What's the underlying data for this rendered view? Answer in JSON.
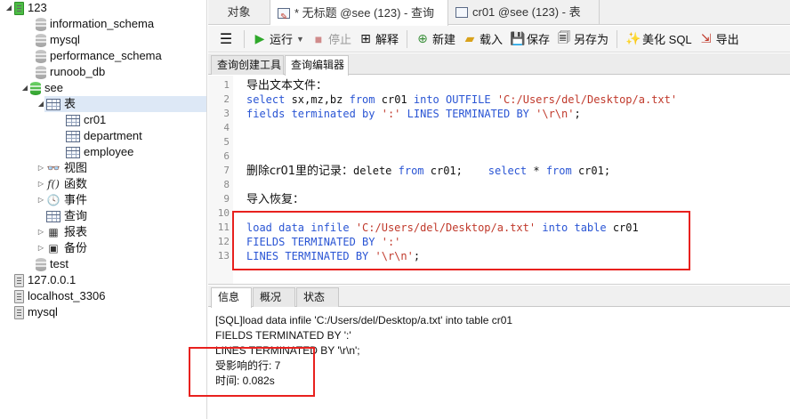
{
  "tree": {
    "conn_123": "123",
    "dbs_123": [
      "information_schema",
      "mysql",
      "performance_schema",
      "runoob_db"
    ],
    "see_db": "see",
    "tables_folder": "表",
    "tables": [
      "cr01",
      "department",
      "employee"
    ],
    "folders": [
      "视图",
      "函数",
      "事件",
      "查询",
      "报表",
      "备份"
    ],
    "test_db": "test",
    "other_connections": [
      "127.0.0.1",
      "localhost_3306",
      "mysql"
    ]
  },
  "top_tabs": [
    "对象",
    "* 无标题 @see (123) - 查询",
    "cr01 @see (123) - 表"
  ],
  "toolbar": {
    "menu_icon": "hamburger-icon",
    "run": "运行",
    "stop": "停止",
    "explain": "解释",
    "new": "新建",
    "load": "载入",
    "save": "保存",
    "save_as": "另存为",
    "beautify": "美化 SQL",
    "export": "导出"
  },
  "sub_tabs": [
    "查询创建工具",
    "查询编辑器"
  ],
  "editor": {
    "line_numbers": [
      "1",
      "2",
      "3",
      "4",
      "5",
      "6",
      "7",
      "8",
      "9",
      "10",
      "11",
      "12",
      "13"
    ],
    "line1": "导出文本文件：",
    "line2": {
      "kw_select": "select",
      "cols": " sx,mz,bz ",
      "kw_from": "from",
      "tbl": " cr01 ",
      "kw_into": "into",
      "sp": " ",
      "kw_outfile": "OUTFILE",
      "path": " 'C:/Users/del/Desktop/a.txt'"
    },
    "line3": {
      "kw1": "fields terminated by",
      "s1": " ':' ",
      "kw2": "LINES TERMINATED BY",
      "s2": " '\\r\\n'",
      "end": ";"
    },
    "line7": {
      "zh": "删除cr01里的记录：",
      "p1": "delete ",
      "kw_from1": "from",
      "p2": " cr01;    ",
      "kw_select": "select",
      "p3": " * ",
      "kw_from2": "from",
      "p4": " cr01;"
    },
    "line9": "导入恢复：",
    "line11": {
      "kw1": "load data infile",
      "path": " 'C:/Users/del/Desktop/a.txt' ",
      "kw2": "into table",
      "tbl": " cr01"
    },
    "line12": {
      "kw": "FIELDS TERMINATED BY",
      "s": " ':'"
    },
    "line13": {
      "kw": "LINES TERMINATED BY",
      "s": " '\\r\\n'",
      "end": ";"
    }
  },
  "result_tabs": [
    "信息",
    "概况",
    "状态"
  ],
  "result": {
    "lines": [
      "[SQL]load data infile 'C:/Users/del/Desktop/a.txt' into table cr01",
      "FIELDS TERMINATED BY ':'",
      "LINES TERMINATED BY '\\r\\n';",
      "受影响的行: 7",
      "时间: 0.082s"
    ]
  },
  "colors": {
    "keyword": "#2a55d4",
    "string": "#c0392b",
    "highlight_box": "#e8211e",
    "selection": "#dde8f6"
  }
}
